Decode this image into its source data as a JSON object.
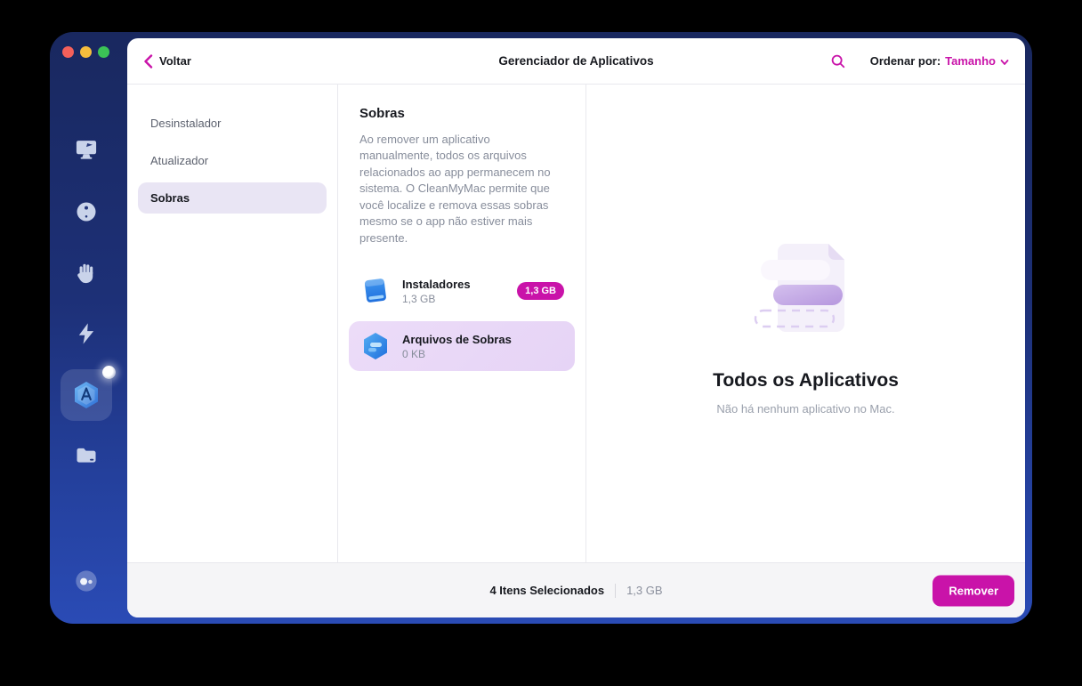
{
  "app": "CleanMyMac",
  "header": {
    "back_label": "Voltar",
    "title": "Gerenciador de Aplicativos",
    "sort_label": "Ordenar por:",
    "sort_value": "Tamanho"
  },
  "sidebar": {
    "icons": [
      "monitor-icon",
      "orb-icon",
      "hand-icon",
      "lightning-icon",
      "applications-icon",
      "folder-icon",
      "assistant-bubble-icon"
    ],
    "active_icon": "applications-icon",
    "has_notification_dot": true
  },
  "nav": {
    "items": [
      {
        "label": "Desinstalador",
        "selected": false
      },
      {
        "label": "Atualizador",
        "selected": false
      },
      {
        "label": "Sobras",
        "selected": true
      }
    ]
  },
  "detail": {
    "title": "Sobras",
    "description": "Ao remover um aplicativo manualmente, todos os arquivos relacionados ao app permanecem no sistema. O CleanMyMac permite que você localize e remova essas sobras mesmo se o app não estiver mais presente.",
    "items": [
      {
        "name": "Instaladores",
        "size": "1,3 GB",
        "badge": "1,3 GB",
        "icon": "installer-disk-icon",
        "selected": false
      },
      {
        "name": "Arquivos de Sobras",
        "size": "0 KB",
        "badge": "",
        "icon": "leftovers-hexagon-icon",
        "selected": true
      }
    ]
  },
  "empty_state": {
    "title": "Todos os Aplicativos",
    "subtitle": "Não há nenhum aplicativo no Mac."
  },
  "footer": {
    "selected_count": "4 Itens Selecionados",
    "selected_size": "1,3 GB",
    "remove_label": "Remover"
  },
  "colors": {
    "accent_magenta": "#C913A9",
    "sidebar_top": "#19285F",
    "sidebar_bottom": "#2A4BB5",
    "selected_row_bg": "#E9D9F6",
    "nav_selected_bg": "#E9E5F4",
    "footer_bg": "#F5F5F7"
  }
}
